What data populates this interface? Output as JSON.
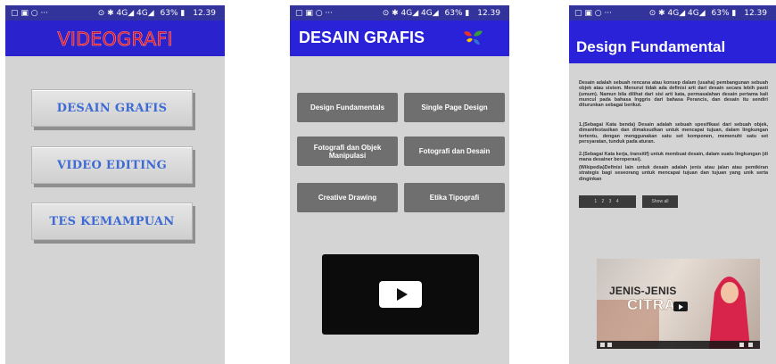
{
  "status": {
    "left_icons": "▢ ▣ ○ ···",
    "right_icons": "⊙ ✱ 4G◢ 4G◢",
    "battery": "63% ▮",
    "time": "12.39"
  },
  "screen1": {
    "app_title": "VIDEOGRAFI",
    "menu": [
      "DESAIN GRAFIS",
      "VIDEO EDITING",
      "TES KEMAMPUAN"
    ]
  },
  "screen2": {
    "app_title": "DESAIN GRAFIS",
    "buttons": [
      "Design Fundamentals",
      "Single Page Design",
      "Fotografi dan Objek Manipulasi",
      "Fotografi dan Desain",
      "Creative Drawing",
      "Etika Tipografi"
    ]
  },
  "screen3": {
    "app_title": "Design Fundamental",
    "paragraphs": [
      "Desain adalah sebuah rencana atau konsep dalam (usaha) pembangunan sebuah objek atau sistem. Menurut tidak ada definisi arti dari desain secara lebih pasti (umum). Namun bila dilihat dari sisi arti kata, permasalahan desain pertama kali muncul pada bahasa Inggris dari bahasa Perancis, dan desain itu sendiri diturunkan sebagai berikut.",
      "1.(Sebagai Kata benda) Desain adalah sebuah spesifikasi dari sebuah objek, dimanifestasikan dan dimaksudkan untuk mencapai tujuan, dalam lingkungan tertentu, dengan menggunakan satu set komponen, memenuhi satu set persyaratan, tunduk pada aturan.",
      "2.(Sebagai Kata kerja, transitif) untuk membuat desain, dalam suatu lingkungan (di mana desainer beroperasi).",
      "(Wikipedia)Definisi lain untuk desain adalah jenis atau jalan atau pemikiran strategis bagi seseorang untuk mencapai tujuan dan tujuan yang unik serta dinginkan"
    ],
    "pager": "1 2 3 4",
    "show_all": "Show all",
    "video_title_line1": "JENIS-JENIS",
    "video_title_line2": "CITRA"
  },
  "colors": {
    "appbar": "#2a22d8",
    "background": "#d4d4d4",
    "menu_text": "#3e6ad4",
    "videografi_title": "#c8102e",
    "grid_button": "#6f6f6f"
  }
}
